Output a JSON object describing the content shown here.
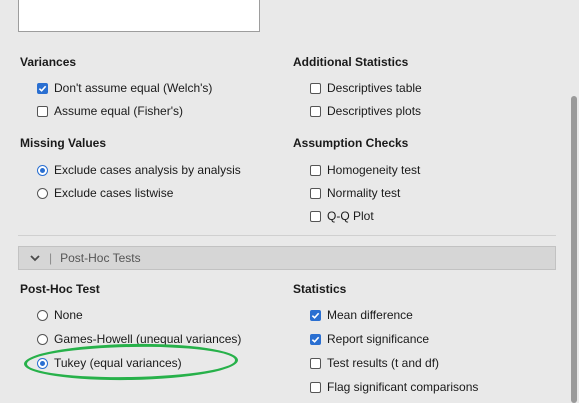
{
  "variances": {
    "heading": "Variances",
    "options": [
      {
        "label": "Don't assume equal (Welch's)",
        "checked": true
      },
      {
        "label": "Assume equal (Fisher's)",
        "checked": false
      }
    ]
  },
  "additional_statistics": {
    "heading": "Additional Statistics",
    "options": [
      {
        "label": "Descriptives table",
        "checked": false
      },
      {
        "label": "Descriptives plots",
        "checked": false
      }
    ]
  },
  "missing_values": {
    "heading": "Missing Values",
    "options": [
      {
        "label": "Exclude cases analysis by analysis",
        "selected": true
      },
      {
        "label": "Exclude cases listwise",
        "selected": false
      }
    ]
  },
  "assumption_checks": {
    "heading": "Assumption Checks",
    "options": [
      {
        "label": "Homogeneity test",
        "checked": false
      },
      {
        "label": "Normality test",
        "checked": false
      },
      {
        "label": "Q-Q Plot",
        "checked": false
      }
    ]
  },
  "posthoc_section": {
    "title": "Post-Hoc Tests",
    "separator": "|"
  },
  "posthoc_test": {
    "heading": "Post-Hoc Test",
    "options": [
      {
        "label": "None",
        "selected": false
      },
      {
        "label": "Games-Howell (unequal variances)",
        "selected": false
      },
      {
        "label": "Tukey (equal variances)",
        "selected": true
      }
    ]
  },
  "statistics": {
    "heading": "Statistics",
    "options": [
      {
        "label": "Mean difference",
        "checked": true
      },
      {
        "label": "Report significance",
        "checked": true
      },
      {
        "label": "Test results (t and df)",
        "checked": false
      },
      {
        "label": "Flag significant comparisons",
        "checked": false
      }
    ]
  },
  "colors": {
    "accent": "#2a6fd1",
    "annotation": "#27b14a"
  }
}
